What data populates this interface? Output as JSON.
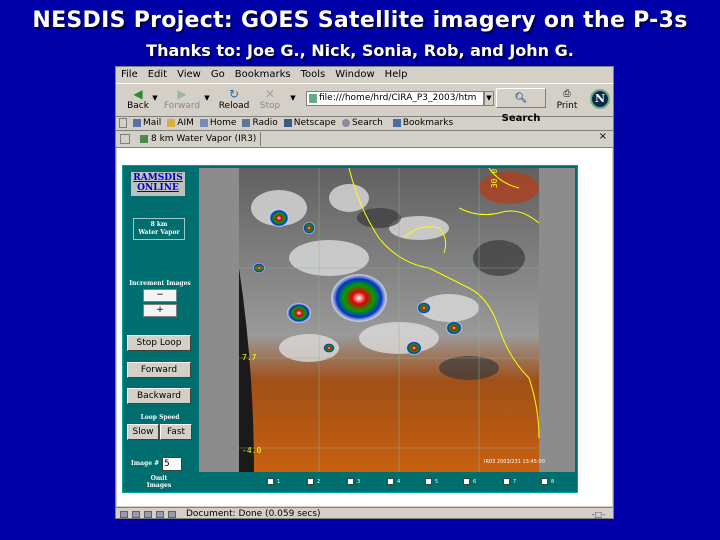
{
  "slide": {
    "title": "NESDIS Project: GOES Satellite imagery on the P-3s",
    "subtitle": "Thanks to: Joe G., Nick, Sonia, Rob, and John G."
  },
  "browser": {
    "menu": [
      "File",
      "Edit",
      "View",
      "Go",
      "Bookmarks",
      "Tools",
      "Window",
      "Help"
    ],
    "nav": {
      "back": "Back",
      "forward": "Forward",
      "reload": "Reload",
      "stop": "Stop",
      "url": "file:///home/hrd/CIRA_P3_2003/htm",
      "search": "Search",
      "print": "Print",
      "logo": "N"
    },
    "personal_toolbar": [
      "Mail",
      "AIM",
      "Home",
      "Radio",
      "Netscape",
      "Search",
      "Bookmarks"
    ],
    "tab_title": "8 km Water Vapor (IR3)",
    "tab_close": "×",
    "status": "Document: Done (0.059 secs)"
  },
  "ramsdis": {
    "title_line1": "RAMSDIS",
    "title_line2": "ONLINE",
    "product_line1": "8 km",
    "product_line2": "Water Vapor",
    "increment_label": "Increment Images",
    "minus": "−",
    "plus": "+",
    "stop_loop": "Stop Loop",
    "forward": "Forward",
    "backward": "Backward",
    "loop_speed_line1": "Loop Speed",
    "loop_speed_line2": "Slow Fast",
    "slow": "Slow",
    "fast": "Fast",
    "image_num_label": "Image #",
    "image_num_value": "5",
    "omit_line1": "Omit",
    "omit_line2": "Images",
    "omit_numbers": [
      "1",
      "2",
      "3",
      "4",
      "5",
      "6",
      "7",
      "8"
    ],
    "map_labels": {
      "lat_top": "30.0",
      "lat_mid": "7.7",
      "lat_low": "-4.0",
      "stamp": "IR03 2003/231 13:45:00"
    }
  },
  "colors": {
    "slide_bg": "#0000a8",
    "panel_teal": "#006e6e",
    "title_text": "#ffffff"
  }
}
